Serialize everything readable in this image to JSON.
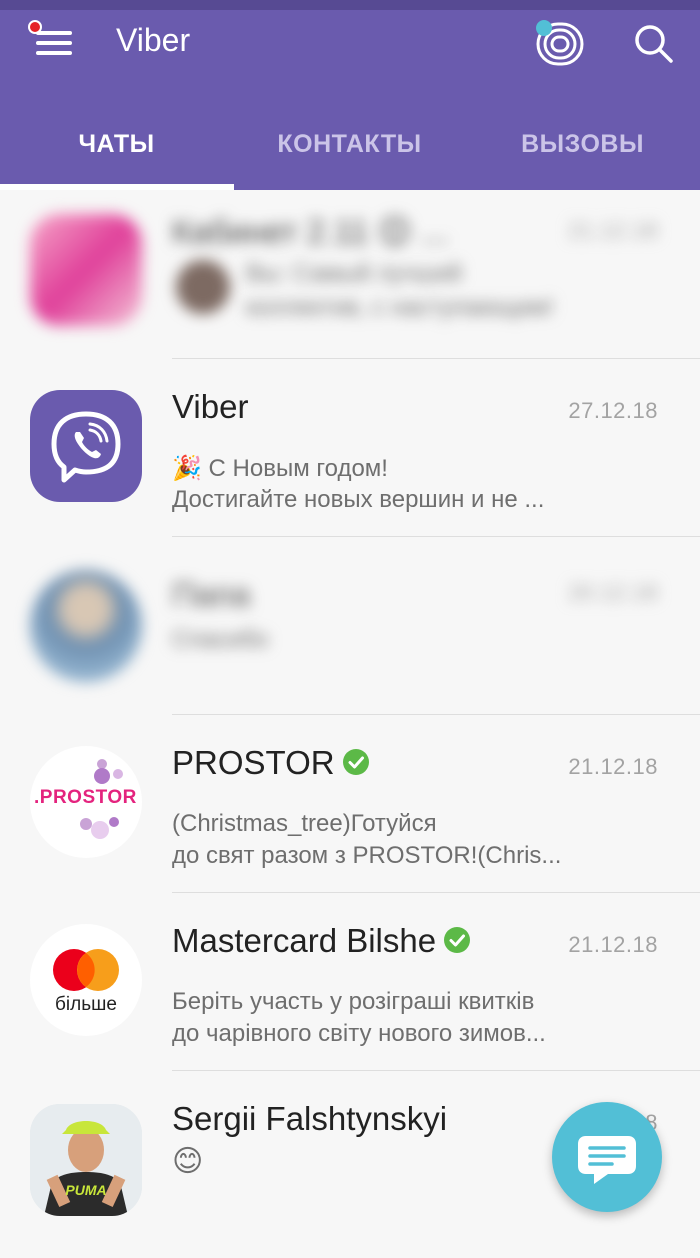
{
  "app": {
    "title": "Viber"
  },
  "tabs": [
    {
      "label": "ЧАТЫ",
      "active": true
    },
    {
      "label": "КОНТАКТЫ",
      "active": false
    },
    {
      "label": "ВЫЗОВЫ",
      "active": false
    }
  ],
  "colors": {
    "brand": "#6a5bae",
    "fab": "#52bfd6",
    "verified": "#5cb947",
    "notification": "#e52227"
  },
  "chats": [
    {
      "name": "Кабинет 2.11 😊 ...",
      "date": "21.12.18",
      "line1": "Вы: Самый лучший",
      "line2": "коллектив, с наступающим!",
      "blurred": true
    },
    {
      "name": "Viber",
      "date": "27.12.18",
      "line1": "🎉 С Новым годом!",
      "line2": "Достигайте новых вершин и не ..."
    },
    {
      "name": "Папа",
      "date": "20.12.18",
      "line1": "Спасибо",
      "blurred": true
    },
    {
      "name": "PROSTOR",
      "date": "21.12.18",
      "line1": "(Christmas_tree)Готуйся",
      "line2": "до свят разом з PROSTOR!(Chris...",
      "verified": true,
      "avatar_text": ".PROSTOR"
    },
    {
      "name": "Mastercard Bilshe",
      "date": "21.12.18",
      "line1": "Беріть участь у розіграші квитків",
      "line2": "до чарівного світу нового зимов...",
      "verified": true,
      "avatar_text": "більше"
    },
    {
      "name": "Sergii Falshtynskyi",
      "date": "21.12.18",
      "line1": "😊",
      "avatar_text": "PUMA"
    }
  ],
  "icons": {
    "menu": "hamburger-icon",
    "stories": "stories-icon",
    "search": "search-icon",
    "compose": "chat-bubble-icon",
    "verified": "check-badge-icon"
  }
}
